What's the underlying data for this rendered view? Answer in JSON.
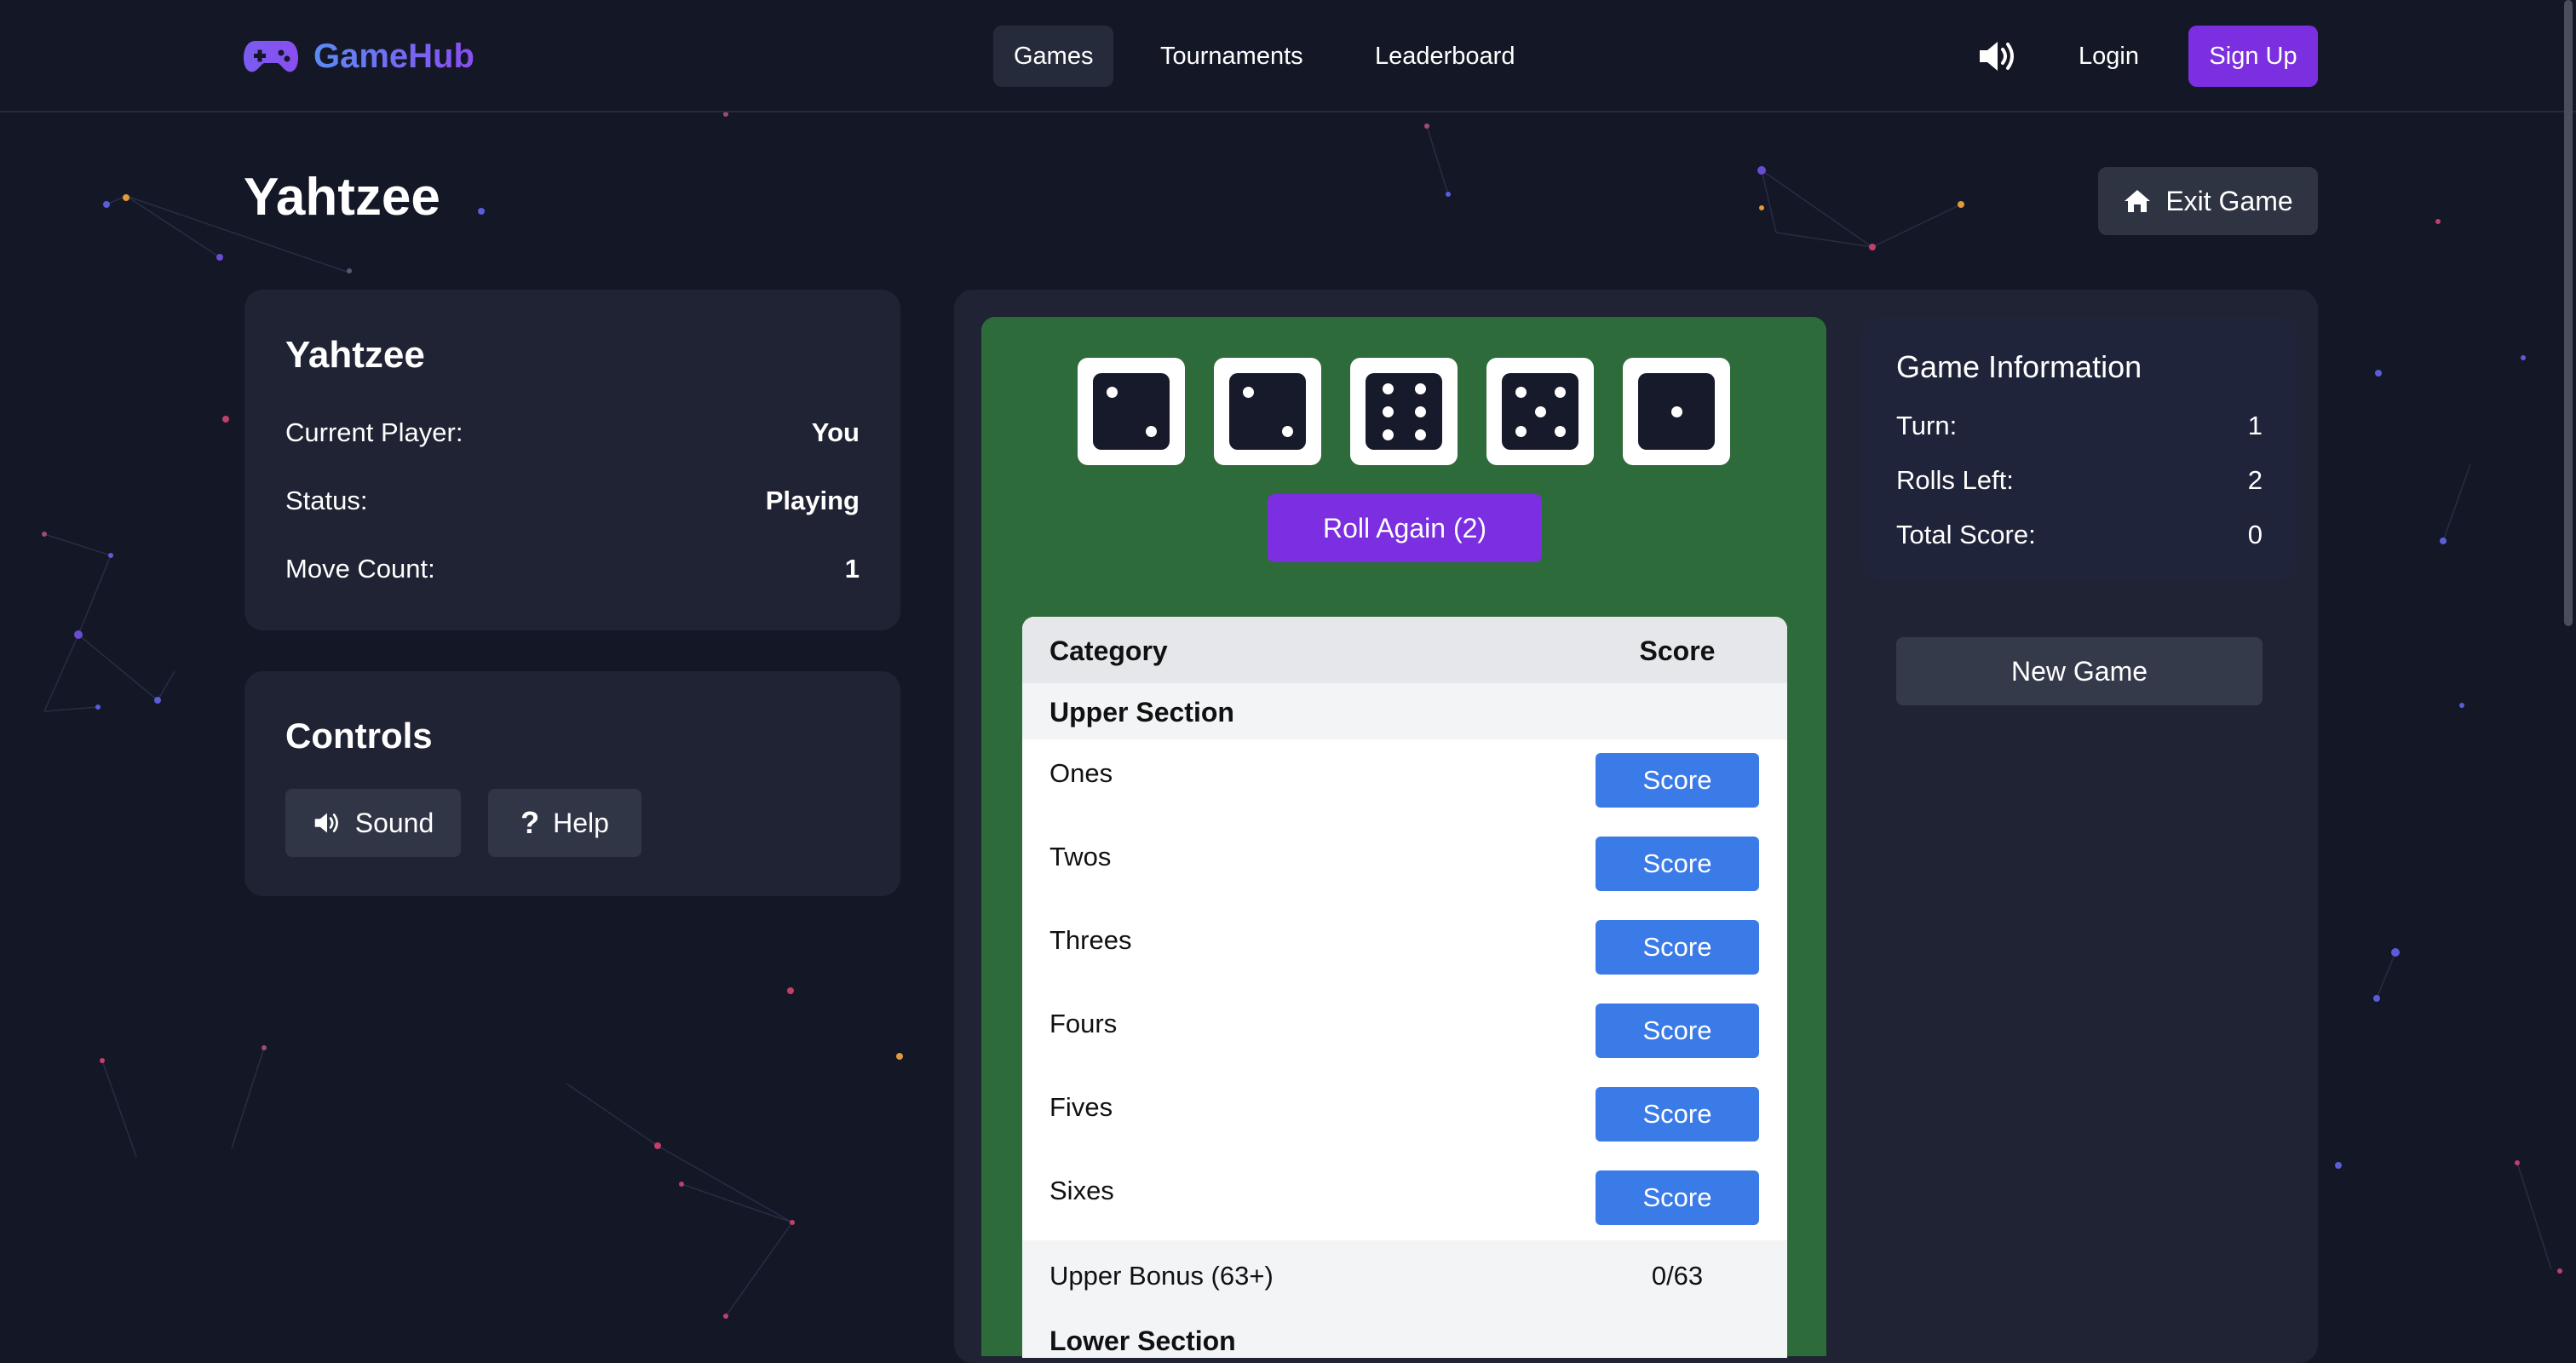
{
  "brand": {
    "name": "GameHub"
  },
  "nav": {
    "games": "Games",
    "tournaments": "Tournaments",
    "leaderboard": "Leaderboard"
  },
  "auth": {
    "login": "Login",
    "signup": "Sign Up"
  },
  "page": {
    "title": "Yahtzee",
    "exit_label": "Exit Game"
  },
  "status_card": {
    "title": "Yahtzee",
    "rows": [
      {
        "label": "Current Player:",
        "value": "You"
      },
      {
        "label": "Status:",
        "value": "Playing"
      },
      {
        "label": "Move Count:",
        "value": "1"
      }
    ]
  },
  "controls": {
    "title": "Controls",
    "sound_label": "Sound",
    "help_label": "Help"
  },
  "dice": [
    2,
    2,
    6,
    5,
    1
  ],
  "roll_button": "Roll Again (2)",
  "score_table": {
    "header_category": "Category",
    "header_score": "Score",
    "upper_section": "Upper Section",
    "rows": [
      {
        "label": "Ones",
        "button": "Score"
      },
      {
        "label": "Twos",
        "button": "Score"
      },
      {
        "label": "Threes",
        "button": "Score"
      },
      {
        "label": "Fours",
        "button": "Score"
      },
      {
        "label": "Fives",
        "button": "Score"
      },
      {
        "label": "Sixes",
        "button": "Score"
      }
    ],
    "bonus_label": "Upper Bonus (63+)",
    "bonus_value": "0/63",
    "lower_section": "Lower Section"
  },
  "game_info": {
    "title": "Game Information",
    "rows": [
      {
        "label": "Turn:",
        "value": "1"
      },
      {
        "label": "Rolls Left:",
        "value": "2"
      },
      {
        "label": "Total Score:",
        "value": "0"
      }
    ],
    "new_game": "New Game"
  },
  "icons": {
    "brand": "gamepad-icon",
    "sound": "speaker-icon",
    "exit": "home-icon",
    "help": "question-icon"
  },
  "colors": {
    "accent": "#7b2fe0",
    "board": "#2e6b3a",
    "score_button": "#3b7be8",
    "background": "#141726"
  }
}
